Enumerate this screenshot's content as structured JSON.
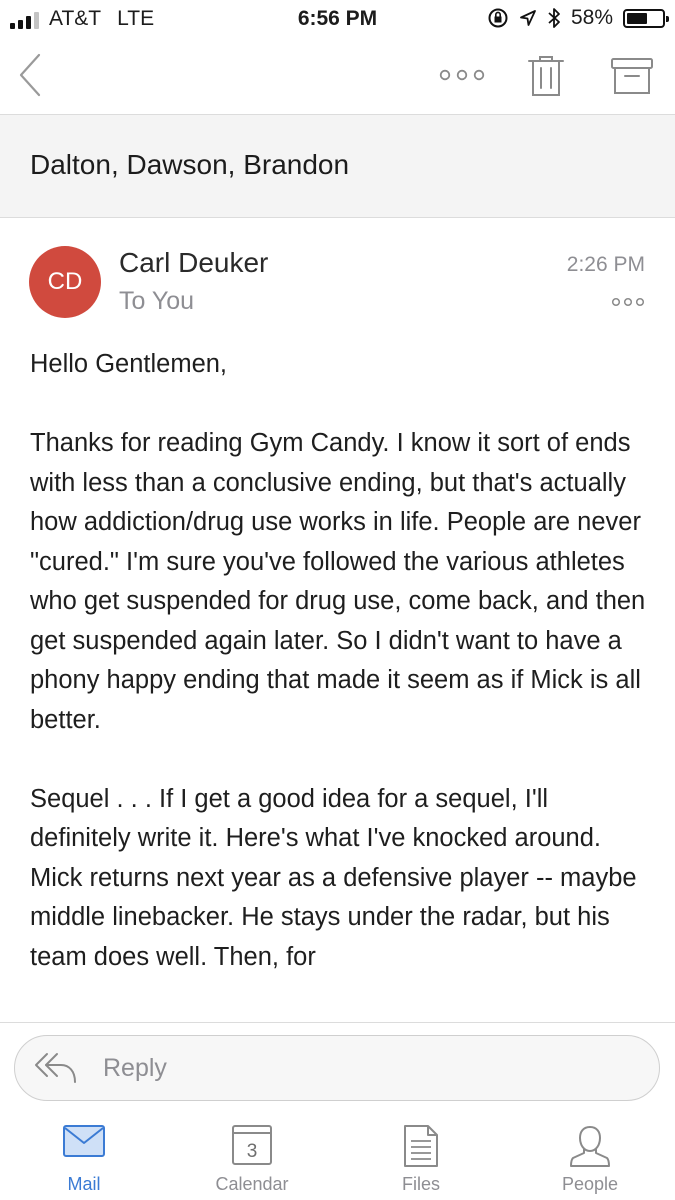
{
  "status_bar": {
    "carrier": "AT&T",
    "network": "LTE",
    "time": "6:56 PM",
    "battery_percent": "58%",
    "battery_level": 0.58
  },
  "toolbar": {
    "back_icon": "chevron-left-icon",
    "more_icon": "more-horizontal-icon",
    "delete_icon": "trash-icon",
    "archive_icon": "archive-icon"
  },
  "thread": {
    "title": "Dalton, Dawson, Brandon"
  },
  "message": {
    "avatar_initials": "CD",
    "avatar_color": "#d04a3e",
    "sender": "Carl Deuker",
    "recipient": "To You",
    "time": "2:26 PM",
    "body": [
      "Hello Gentlemen,",
      "Thanks for reading Gym Candy. I know it sort of ends with less than a conclusive ending, but that's actually how addiction/drug use works in life. People are never \"cured.\" I'm sure you've followed the various athletes who get suspended for drug use, come back, and then get suspended again later. So I didn't want to have a phony happy ending that made it seem as if Mick is all better.",
      "Sequel . . . If I get a good idea for a sequel, I'll definitely write it. Here's what I've knocked around. Mick returns next year as a defensive player -- maybe middle linebacker. He stays under the radar, but his team does well. Then, for"
    ]
  },
  "reply": {
    "placeholder": "Reply"
  },
  "tabs": [
    {
      "label": "Mail",
      "icon": "mail-icon",
      "active": true
    },
    {
      "label": "Calendar",
      "icon": "calendar-icon",
      "badge": "3",
      "active": false
    },
    {
      "label": "Files",
      "icon": "file-icon",
      "active": false
    },
    {
      "label": "People",
      "icon": "person-icon",
      "active": false
    }
  ],
  "colors": {
    "accent": "#3b7bd4",
    "muted": "#8e8e93",
    "icon_gray": "#8a8a8a"
  }
}
